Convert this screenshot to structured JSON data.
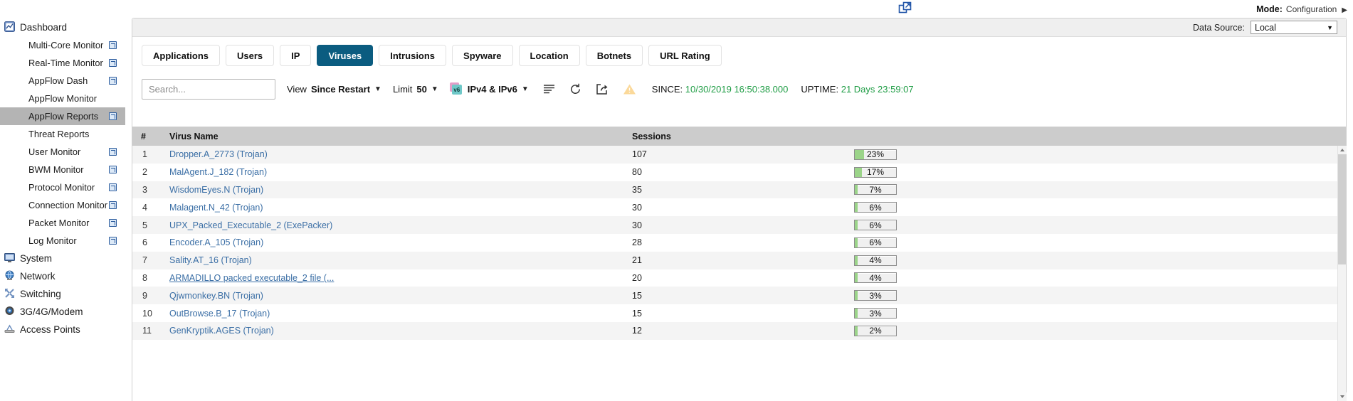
{
  "header": {
    "mode_label": "Mode:",
    "mode_value": "Configuration",
    "mode_caret": "▶",
    "popout_icon": "popout-window-icon"
  },
  "data_source": {
    "label": "Data Source:",
    "value": "Local",
    "caret": "▼"
  },
  "tabs": [
    {
      "label": "Applications",
      "active": false
    },
    {
      "label": "Users",
      "active": false
    },
    {
      "label": "IP",
      "active": false
    },
    {
      "label": "Viruses",
      "active": true
    },
    {
      "label": "Intrusions",
      "active": false
    },
    {
      "label": "Spyware",
      "active": false
    },
    {
      "label": "Location",
      "active": false
    },
    {
      "label": "Botnets",
      "active": false
    },
    {
      "label": "URL Rating",
      "active": false
    }
  ],
  "toolbar": {
    "search_placeholder": "Search...",
    "view_label": "View",
    "view_value": "Since Restart",
    "limit_label": "Limit",
    "limit_value": "50",
    "ip_badge": "v6",
    "ip_value": "IPv4 & IPv6",
    "caret": "▼",
    "icons": [
      "list-lines-icon",
      "refresh-icon",
      "export-share-icon",
      "warning-triangle-icon"
    ],
    "since_key": "SINCE:",
    "since_value": "10/30/2019 16:50:38.000",
    "uptime_key": "UPTIME:",
    "uptime_value": "21 Days 23:59:07"
  },
  "sidebar": {
    "groups": [
      {
        "label": "Dashboard",
        "icon": "dashboard-chart-icon",
        "items": [
          {
            "label": "Multi-Core Monitor",
            "badge": true,
            "active": false
          },
          {
            "label": "Real-Time Monitor",
            "badge": true,
            "active": false
          },
          {
            "label": "AppFlow Dash",
            "badge": true,
            "active": false
          },
          {
            "label": "AppFlow Monitor",
            "badge": false,
            "active": false
          },
          {
            "label": "AppFlow Reports",
            "badge": true,
            "active": true
          },
          {
            "label": "Threat Reports",
            "badge": false,
            "active": false
          },
          {
            "label": "User Monitor",
            "badge": true,
            "active": false
          },
          {
            "label": "BWM Monitor",
            "badge": true,
            "active": false
          },
          {
            "label": "Protocol Monitor",
            "badge": true,
            "active": false
          },
          {
            "label": "Connection Monitor",
            "badge": true,
            "active": false
          },
          {
            "label": "Packet Monitor",
            "badge": true,
            "active": false
          },
          {
            "label": "Log Monitor",
            "badge": true,
            "active": false
          }
        ]
      },
      {
        "label": "System",
        "icon": "monitor-icon",
        "items": []
      },
      {
        "label": "Network",
        "icon": "globe-icon",
        "items": []
      },
      {
        "label": "Switching",
        "icon": "switching-arrows-icon",
        "items": []
      },
      {
        "label": "3G/4G/Modem",
        "icon": "modem-icon",
        "items": []
      },
      {
        "label": "Access Points",
        "icon": "access-point-icon",
        "items": []
      }
    ]
  },
  "table": {
    "columns": [
      "#",
      "Virus Name",
      "Sessions",
      ""
    ],
    "rows": [
      {
        "num": "1",
        "name": "Dropper.A_2773 (Trojan)",
        "sessions": "107",
        "pct_label": "23%",
        "pct": 23,
        "underline": false
      },
      {
        "num": "2",
        "name": "MalAgent.J_182 (Trojan)",
        "sessions": "80",
        "pct_label": "17%",
        "pct": 17,
        "underline": false
      },
      {
        "num": "3",
        "name": "WisdomEyes.N (Trojan)",
        "sessions": "35",
        "pct_label": "7%",
        "pct": 7,
        "underline": false
      },
      {
        "num": "4",
        "name": "Malagent.N_42 (Trojan)",
        "sessions": "30",
        "pct_label": "6%",
        "pct": 6,
        "underline": false
      },
      {
        "num": "5",
        "name": "UPX_Packed_Executable_2 (ExePacker)",
        "sessions": "30",
        "pct_label": "6%",
        "pct": 6,
        "underline": false
      },
      {
        "num": "6",
        "name": "Encoder.A_105 (Trojan)",
        "sessions": "28",
        "pct_label": "6%",
        "pct": 6,
        "underline": false
      },
      {
        "num": "7",
        "name": "Sality.AT_16 (Trojan)",
        "sessions": "21",
        "pct_label": "4%",
        "pct": 4,
        "underline": false
      },
      {
        "num": "8",
        "name": "ARMADILLO packed executable_2 file (...",
        "sessions": "20",
        "pct_label": "4%",
        "pct": 4,
        "underline": true
      },
      {
        "num": "9",
        "name": "Qjwmonkey.BN (Trojan)",
        "sessions": "15",
        "pct_label": "3%",
        "pct": 3,
        "underline": false
      },
      {
        "num": "10",
        "name": "OutBrowse.B_17 (Trojan)",
        "sessions": "15",
        "pct_label": "3%",
        "pct": 3,
        "underline": false
      },
      {
        "num": "11",
        "name": "GenKryptik.AGES (Trojan)",
        "sessions": "12",
        "pct_label": "2%",
        "pct": 2,
        "underline": false
      }
    ]
  },
  "colors": {
    "accent": "#0b5c80",
    "link": "#3a6ea5",
    "bar_fill": "#9bd489",
    "green_text": "#1f9d45",
    "header_bg": "#cccccc"
  }
}
